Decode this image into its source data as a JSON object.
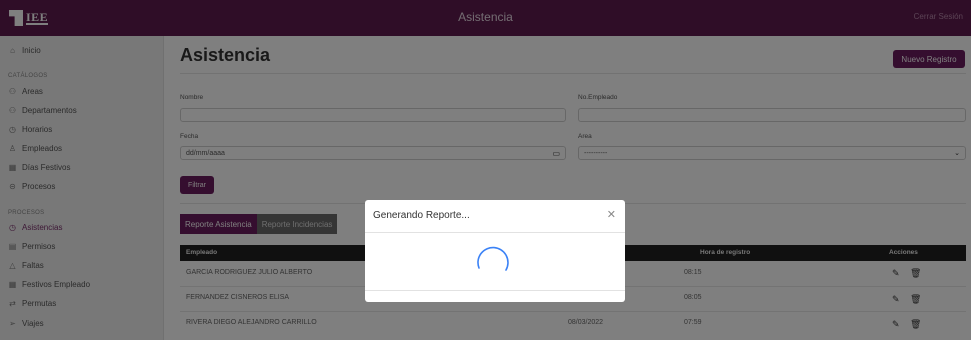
{
  "header": {
    "logo_text": "IEE",
    "title": "Asistencia",
    "logout_label": "Cerrar Sesión"
  },
  "sidebar": {
    "home": "Inicio",
    "section_catalogs": "CATÁLOGOS",
    "catalogs": [
      "Areas",
      "Departamentos",
      "Horarios",
      "Empleados",
      "Días Festivos",
      "Procesos"
    ],
    "section_processes": "PROCESOS",
    "processes": [
      "Asistencias",
      "Permisos",
      "Faltas",
      "Festivos Empleado",
      "Permutas",
      "Viajes"
    ],
    "active": "Asistencias"
  },
  "page": {
    "title": "Asistencia",
    "new_button": "Nuevo Registro"
  },
  "filters": {
    "nombre_label": "Nombre",
    "nombre_value": "",
    "empleado_label": "No.Empleado",
    "empleado_value": "",
    "fecha_label": "Fecha",
    "fecha_placeholder": "dd/mm/aaaa",
    "area_label": "Area",
    "area_value": "----------",
    "filter_button": "Filtrar"
  },
  "tabs": [
    "Reporte Asistencia",
    "Reporte Incidencias"
  ],
  "table": {
    "headers": {
      "empleado": "Empleado",
      "hora": "Hora de registro",
      "acciones": "Acciones"
    },
    "rows": [
      {
        "empleado": "GARCIA RODRIGUEZ JULIO ALBERTO",
        "fecha": "",
        "hora": "08:15"
      },
      {
        "empleado": "FERNANDEZ CISNEROS ELISA",
        "fecha": "",
        "hora": "08:05"
      },
      {
        "empleado": "RIVERA DIEGO ALEJANDRO CARRILLO",
        "fecha": "08/03/2022",
        "hora": "07:59"
      }
    ]
  },
  "modal": {
    "title": "Generando Reporte..."
  },
  "colors": {
    "brand": "#5e1b4f",
    "button": "#6b1d5e",
    "spinner": "#3b82f6"
  }
}
